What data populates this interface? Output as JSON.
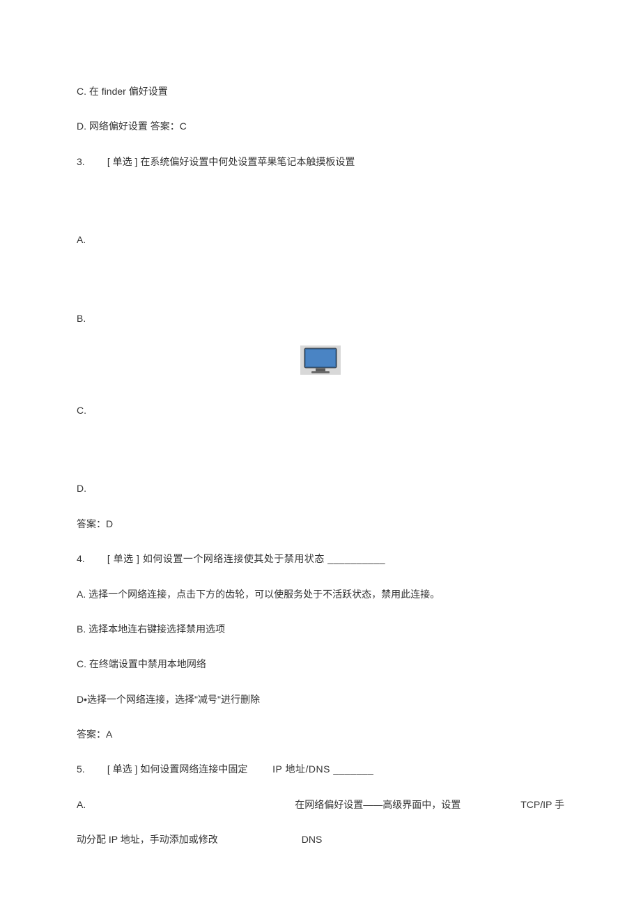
{
  "lines": {
    "q2_c": "C.  在 finder 偏好设置",
    "q2_d": "D.  网络偏好设置 答案：C",
    "q3_prompt_num": "3.",
    "q3_prompt_text": "[ 单选 ] 在系统偏好设置中何处设置苹果笔记本触摸板设置",
    "q3_a": "A.",
    "q3_b": "B.",
    "q3_c": "C.",
    "q3_d": "D.",
    "q3_answer": "答案：D",
    "q4_prompt_num": "4.",
    "q4_prompt_text": "[ 单选 ] 如何设置一个网络连接使其处于禁用状态 __________",
    "q4_a": "A.  选择一个网络连接，点击下方的齿轮，可以使服务处于不活跃状态，禁用此连接。",
    "q4_b": "B.  选择本地连右键接选择禁用选项",
    "q4_c": "C.  在终端设置中禁用本地网络",
    "q4_d": "D•选择一个网络连接，选择\"减号\"进行删除",
    "q4_answer": "答案：A",
    "q5_prompt_num": "5.",
    "q5_prompt_text_a": "[ 单选 ] 如何设置网络连接中固定",
    "q5_prompt_text_b": "IP 地址/DNS _______",
    "q5_a_left": "A.",
    "q5_a_mid": "在网络偏好设置——高级界面中，设置",
    "q5_a_right": "TCP/IP 手",
    "q5_a_line2_left": "动分配 IP 地址，手动添加或修改",
    "q5_a_line2_right": "DNS"
  },
  "icon": {
    "monitor_name": "monitor-icon"
  }
}
